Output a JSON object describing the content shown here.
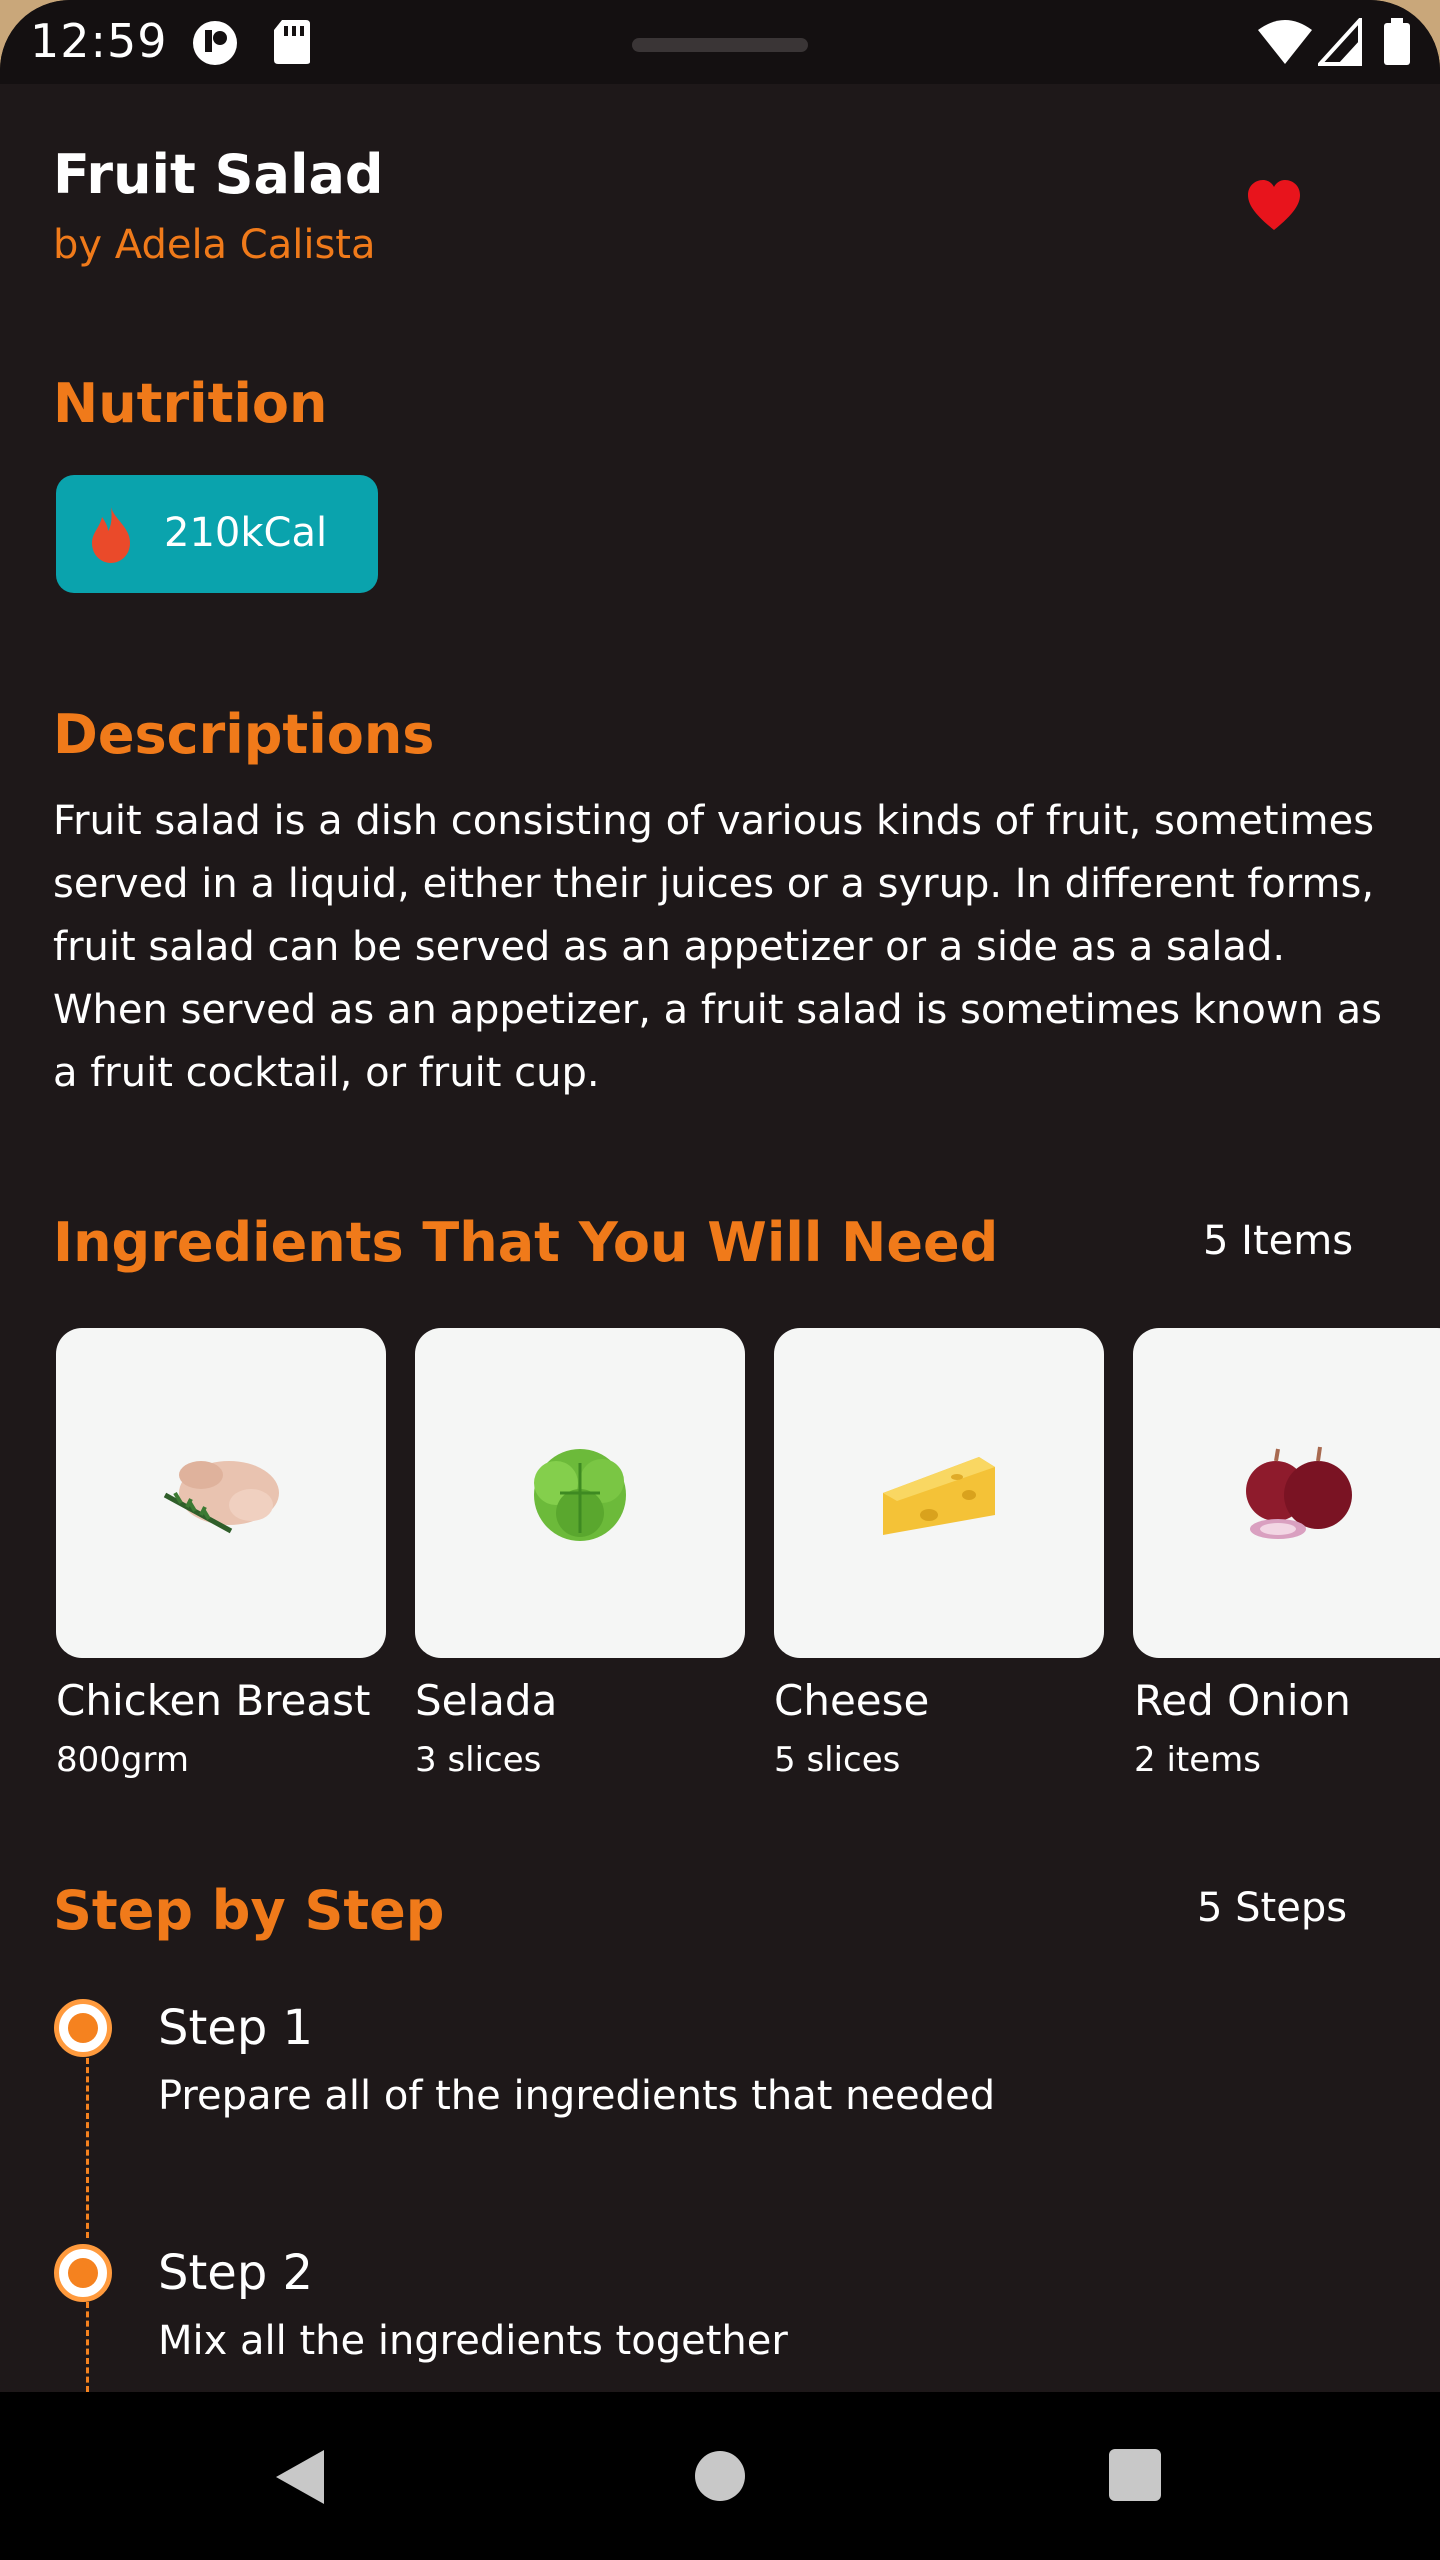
{
  "status_bar": {
    "time": "12:59",
    "icons": [
      "media-icon",
      "sd-card-icon",
      "wifi-icon",
      "signal-icon",
      "battery-icon"
    ]
  },
  "recipe": {
    "title": "Fruit Salad",
    "author": "by Adela Calista",
    "favorite_icon": "heart-icon",
    "favorite_color": "#e8141c"
  },
  "nutrition": {
    "heading": "Nutrition",
    "calories": "210kCal",
    "icon": "flame-icon"
  },
  "descriptions": {
    "heading": "Descriptions",
    "text": "Fruit salad is a dish consisting of various kinds of fruit, sometimes served in a liquid, either their juices or a syrup. In different forms, fruit salad can be served as an appetizer or a side as a salad. When served as an appetizer, a fruit salad is sometimes known as a fruit cocktail, or fruit cup."
  },
  "ingredients": {
    "heading": "Ingredients That You Will Need",
    "count": "5 Items",
    "items": [
      {
        "name": "Chicken Breast",
        "qty": "800grm",
        "icon": "chicken-icon"
      },
      {
        "name": "Selada",
        "qty": "3 slices",
        "icon": "lettuce-icon"
      },
      {
        "name": "Cheese",
        "qty": "5 slices",
        "icon": "cheese-icon"
      },
      {
        "name": "Red Onion",
        "qty": "2 items",
        "icon": "red-onion-icon"
      }
    ]
  },
  "steps": {
    "heading": "Step by Step",
    "count": "5 Steps",
    "items": [
      {
        "title": "Step 1",
        "text": "Prepare all of the ingredients that needed"
      },
      {
        "title": "Step 2",
        "text": "Mix all the ingredients together"
      }
    ]
  },
  "navigation": {
    "buttons": [
      "back-icon",
      "home-icon",
      "recents-icon"
    ]
  },
  "colors": {
    "accent": "#f07a1a",
    "background": "#1e1819",
    "nutrition_pill": "#0aa3ad",
    "card": "#f5f6f5"
  }
}
